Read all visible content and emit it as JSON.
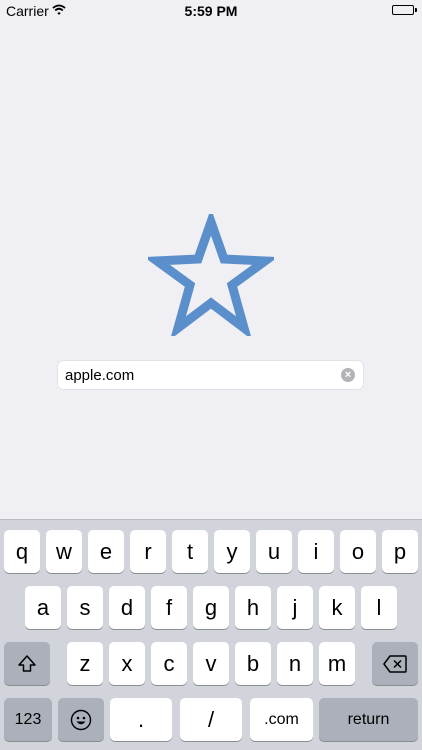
{
  "status_bar": {
    "carrier": "Carrier",
    "time": "5:59 PM"
  },
  "bookmark": {
    "icon": "star-outline-icon",
    "color": "#5a8fcb"
  },
  "url_field": {
    "value": "apple.com"
  },
  "keyboard": {
    "row1": [
      "q",
      "w",
      "e",
      "r",
      "t",
      "y",
      "u",
      "i",
      "o",
      "p"
    ],
    "row2": [
      "a",
      "s",
      "d",
      "f",
      "g",
      "h",
      "j",
      "k",
      "l"
    ],
    "row3": [
      "z",
      "x",
      "c",
      "v",
      "b",
      "n",
      "m"
    ],
    "numbers_label": "123",
    "dot_label": ".",
    "slash_label": "/",
    "dotcom_label": ".com",
    "return_label": "return"
  }
}
